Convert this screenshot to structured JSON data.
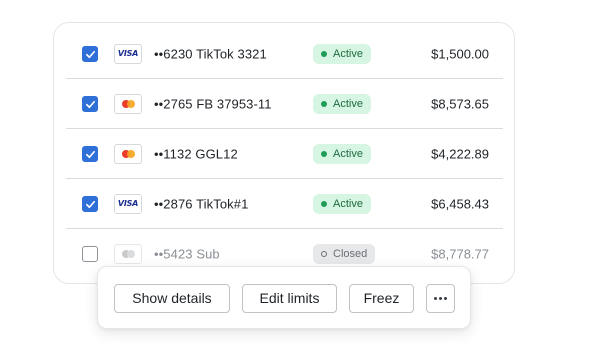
{
  "accounts": [
    {
      "checked": true,
      "brand": "VISA",
      "brand_icon": "visa-logo",
      "name": "••6230 TikTok 3321",
      "status": "Active",
      "amount": "$1,500.00"
    },
    {
      "checked": true,
      "brand": "",
      "brand_icon": "mastercard-logo",
      "name": "••2765 FB 37953-11",
      "status": "Active",
      "amount": "$8,573.65"
    },
    {
      "checked": true,
      "brand": "",
      "brand_icon": "mastercard-logo",
      "name": "••1132 GGL12",
      "status": "Active",
      "amount": "$4,222.89"
    },
    {
      "checked": true,
      "brand": "VISA",
      "brand_icon": "visa-logo",
      "name": "••2876 TikTok#1",
      "status": "Active",
      "amount": "$6,458.43"
    },
    {
      "checked": false,
      "brand": "",
      "brand_icon": "mastercard-logo",
      "name": "••5423 Sub",
      "status": "Closed",
      "amount": "$8,778.77"
    }
  ],
  "actions": {
    "show_details": "Show details",
    "edit_limits": "Edit limits",
    "freez": "Freez",
    "more_icon": "more-horizontal-icon"
  },
  "colors": {
    "checkbox_checked": "#2f6fd8",
    "active_badge_bg": "#d6f5e3",
    "active_badge_text": "#1d6b3f",
    "active_dot": "#1f9d57",
    "closed_badge_bg": "#e7e8ea",
    "mastercard_red": "#eb3b2a",
    "mastercard_orange": "#f5a623",
    "visa_blue": "#1a2d8f"
  }
}
